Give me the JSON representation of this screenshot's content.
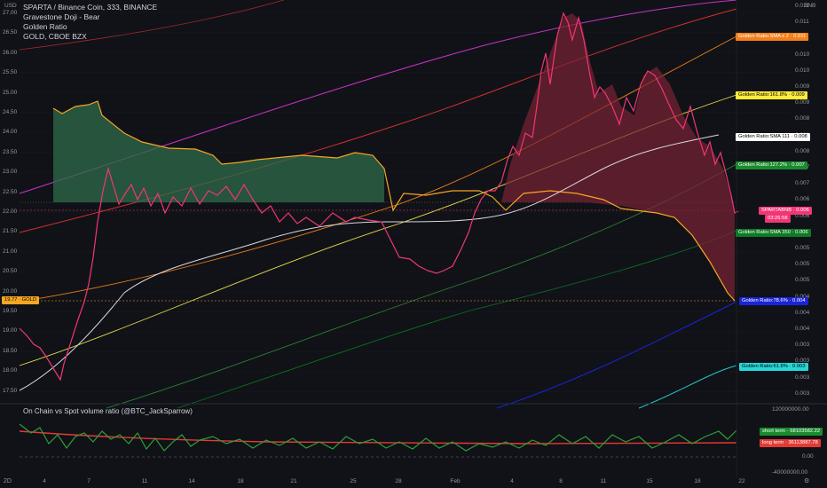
{
  "legend": {
    "title": "SPARTA / Binance Coin, 333, BINANCE",
    "line2": "Gravestone Doji - Bear",
    "line3": "Golden Ratio",
    "line4": "GOLD, CBOE BZX"
  },
  "left_axis": {
    "currency": "USD",
    "ticks": [
      "27.00",
      "26.50",
      "26.00",
      "25.50",
      "25.00",
      "24.50",
      "24.00",
      "23.50",
      "23.00",
      "22.50",
      "22.00",
      "21.50",
      "21.00",
      "20.50",
      "20.00",
      "19.50",
      "19.00",
      "18.50",
      "18.00",
      "17.50"
    ]
  },
  "right_axis": {
    "currency": "BNB",
    "ticks": [
      "0.011",
      "0.011",
      "0.011",
      "0.010",
      "0.010",
      "0.009",
      "0.009",
      "0.008",
      "0.008",
      "0.008",
      "0.007",
      "0.007",
      "0.006",
      "0.006",
      "0.006",
      "0.005",
      "0.005",
      "0.005",
      "0.004",
      "0.004",
      "0.004",
      "0.003",
      "0.003",
      "0.003",
      "0.003"
    ]
  },
  "gold_tag": {
    "label": "19.77 · GOLD",
    "color": "#f5a623"
  },
  "price_tags": [
    {
      "label": "Golden Ratio:SMA x 2 · 0.011",
      "bg": "#f57f17",
      "fg": "#ffffff"
    },
    {
      "label": "Golden Ratio:161.8% · 0.009",
      "bg": "#ffeb3b",
      "fg": "#000000"
    },
    {
      "label": "Golden Ratio:SMA 111 · 0.008",
      "bg": "#ffffff",
      "fg": "#000000"
    },
    {
      "label": "Golden Ratio:127.2% · 0.007",
      "bg": "#1b8a2f",
      "fg": "#ffffff"
    },
    {
      "label": "SPARTABNB · 0.006",
      "bg": "#f23674",
      "fg": "#ffffff"
    },
    {
      "label": "03:26:58",
      "bg": "#f23674",
      "fg": "#ffffff"
    },
    {
      "label": "Golden Ratio:SMA 350 · 0.006",
      "bg": "#0e7a26",
      "fg": "#ffffff"
    },
    {
      "label": "Golden Ratio:78.6% · 0.004",
      "bg": "#1a23d6",
      "fg": "#ffffff"
    },
    {
      "label": "Golden Ratio:61.8% · 0.003",
      "bg": "#26d7d7",
      "fg": "#000000"
    }
  ],
  "oscillator": {
    "title": "On Chain vs Spot volume ratio (@BTC_JackSparrow)",
    "axis_ticks": [
      "120000000.00",
      "0.00",
      "-40000000.00"
    ],
    "tags": [
      {
        "label": "short term · 68103582.22",
        "bg": "#1b8a2f",
        "fg": "#ffffff"
      },
      {
        "label": "long term · 36113887.78",
        "bg": "#e53935",
        "fg": "#ffffff"
      }
    ]
  },
  "x_axis": {
    "ticks": [
      "4",
      "7",
      "11",
      "14",
      "18",
      "21",
      "25",
      "28",
      "Feb",
      "4",
      "8",
      "11",
      "15",
      "18",
      "22"
    ]
  },
  "corner": {
    "left": "2D",
    "right": "⚙"
  },
  "colors": {
    "price_line": "#f23674",
    "fill_above": "#2e6b4a",
    "fill_below": "#7a2235",
    "orange_outline": "#f5a623",
    "sma111": "#d8d8e0",
    "sma2": "#f57f17",
    "fib161": "#ffeb3b",
    "fib127": "#2e7d32",
    "sma350": "#0e7a26",
    "fib786": "#1a23d6",
    "fib618": "#26c6c6",
    "magenta": "#c931c9",
    "red_band": "#d32f2f",
    "osc_short": "#2e9e3a",
    "osc_long": "#e53935"
  }
}
